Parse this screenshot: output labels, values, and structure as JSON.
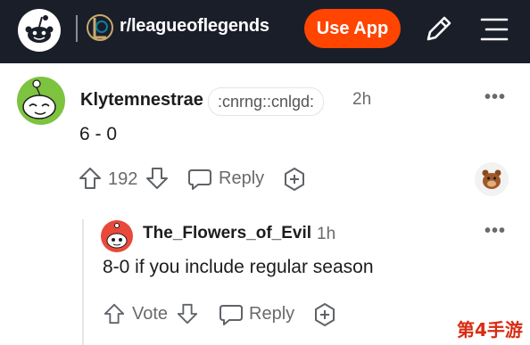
{
  "header": {
    "subreddit": "r/leagueoflegends",
    "cta_label": "Use App"
  },
  "comment": {
    "author": "Klytemnestrae",
    "flair": ":cnrng::cnlgd:",
    "age": "2h",
    "body": "6 - 0",
    "score": "192",
    "reply_label": "Reply",
    "more": "•••"
  },
  "reply": {
    "author": "The_Flowers_of_Evil",
    "age": "1h",
    "body": "8-0 if you include regular season",
    "vote_label": "Vote",
    "reply_label": "Reply",
    "more": "•••"
  },
  "watermark": "第4手游",
  "colors": {
    "header_bg": "#1a1e29",
    "accent": "#ff4500",
    "avatar_green": "#7ec340",
    "avatar_red": "#e8493a"
  }
}
